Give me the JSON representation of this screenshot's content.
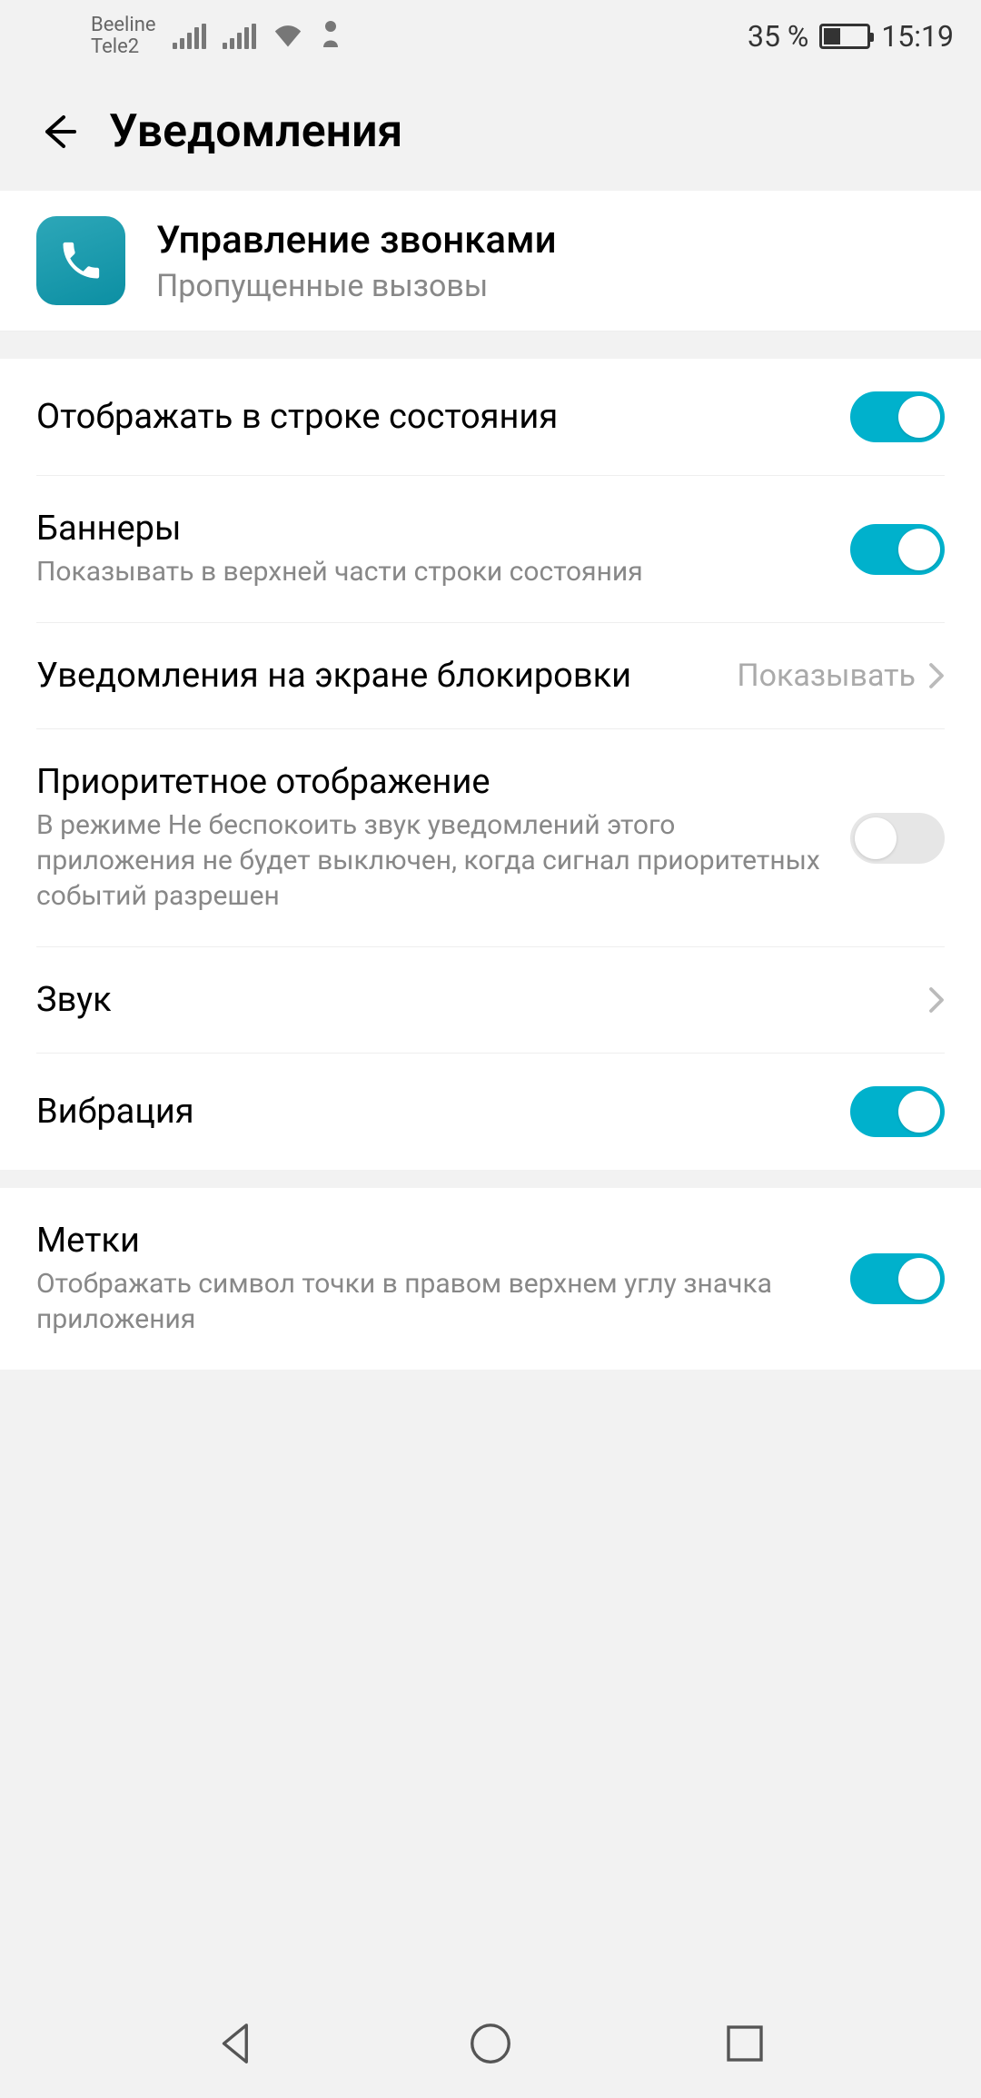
{
  "statusbar": {
    "carrier1": "Beeline",
    "carrier2": "Tele2",
    "battery_text": "35 %",
    "clock": "15:19"
  },
  "header": {
    "title": "Уведомления"
  },
  "app": {
    "title": "Управление звонками",
    "subtitle": "Пропущенные вызовы"
  },
  "settings": {
    "show_status_bar": {
      "title": "Отображать в строке состояния",
      "on": true
    },
    "banners": {
      "title": "Баннеры",
      "sub": "Показывать в верхней части строки состояния",
      "on": true
    },
    "lockscreen": {
      "title": "Уведомления на экране блокировки",
      "value": "Показывать"
    },
    "priority": {
      "title": "Приоритетное отображение",
      "sub": "В режиме Не беспокоить звук уведомлений этого приложения не будет выключен, когда сигнал приоритетных событий разрешен",
      "on": false
    },
    "sound": {
      "title": "Звук"
    },
    "vibration": {
      "title": "Вибрация",
      "on": true
    },
    "badges": {
      "title": "Метки",
      "sub": "Отображать символ точки в правом верхнем углу значка приложения",
      "on": true
    }
  }
}
